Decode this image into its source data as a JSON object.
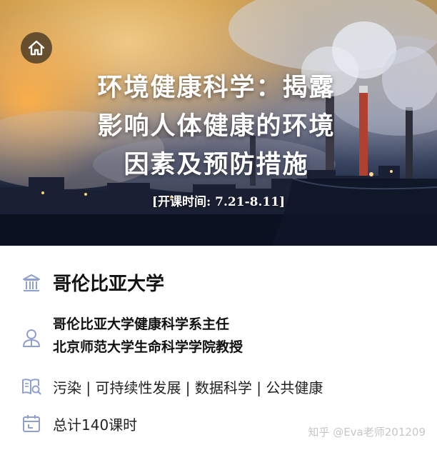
{
  "hero": {
    "title_lines": [
      "环境健康科学：揭露",
      "影响人体健康的环境",
      "因素及预防措施"
    ],
    "dates": "[开课时间: 7.21-8.11]",
    "home_icon": "home-icon"
  },
  "university": {
    "name": "哥伦比亚大学",
    "icon": "university-building-icon"
  },
  "instructor": {
    "titles": [
      "哥伦比亚大学健康科学系主任",
      "北京师范大学生命科学学院教授"
    ],
    "icon": "person-icon"
  },
  "topics": {
    "text": "污染 | 可持续性发展 | 数据科学 | 公共健康",
    "icon": "book-search-icon"
  },
  "hours": {
    "text": "总计140课时",
    "icon": "calendar-icon"
  },
  "watermark": "知乎 @Eva老师201209",
  "colors": {
    "icon_blue": "#8f9fd0",
    "text": "#111111",
    "watermark": "#c6c6c6"
  }
}
